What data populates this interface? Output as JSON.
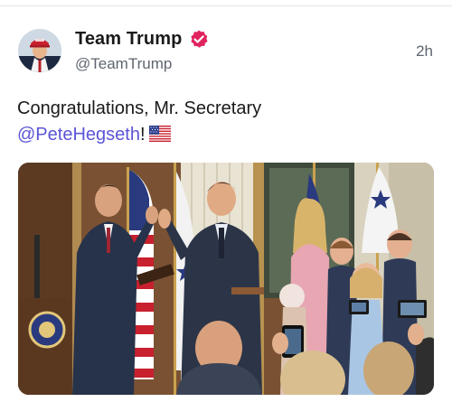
{
  "author": {
    "display_name": "Team Trump",
    "handle": "@TeamTrump",
    "verified": true,
    "avatar_icon": "avatar-photo"
  },
  "post": {
    "time": "2h",
    "text_line1": "Congratulations, Mr. Secretary",
    "mention": "@PeteHegseth",
    "text_after_mention": "!",
    "emoji": "us-flag"
  },
  "colors": {
    "mention": "#5b55d6",
    "verified_badge": "#e0245e",
    "secondary_text": "#5f6670"
  },
  "media": {
    "type": "photo"
  }
}
